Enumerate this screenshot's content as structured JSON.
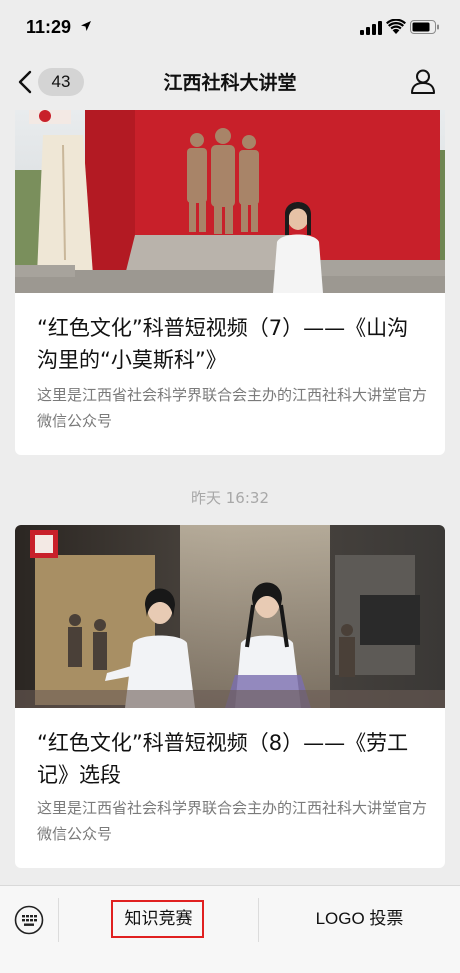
{
  "status_bar": {
    "time": "11:29"
  },
  "nav": {
    "back_count": "43",
    "title": "江西社科大讲堂"
  },
  "articles": [
    {
      "title": "“红色文化”科普短视频（7）——《山沟沟里的“小莫斯科”》",
      "description": "这里是江西省社会科学界联合会主办的江西社科大讲堂官方微信公众号"
    },
    {
      "title": "“红色文化”科普短视频（8）——《劳工记》选段",
      "description": "这里是江西省社会科学界联合会主办的江西社科大讲堂官方微信公众号"
    }
  ],
  "timestamp": "昨天 16:32",
  "bottom_menu": {
    "items": [
      {
        "label": "知识竞赛"
      },
      {
        "label": "LOGO 投票"
      }
    ]
  },
  "colors": {
    "background": "#ededed",
    "highlight": "#e02020",
    "desc_text": "#7a7a7a"
  }
}
